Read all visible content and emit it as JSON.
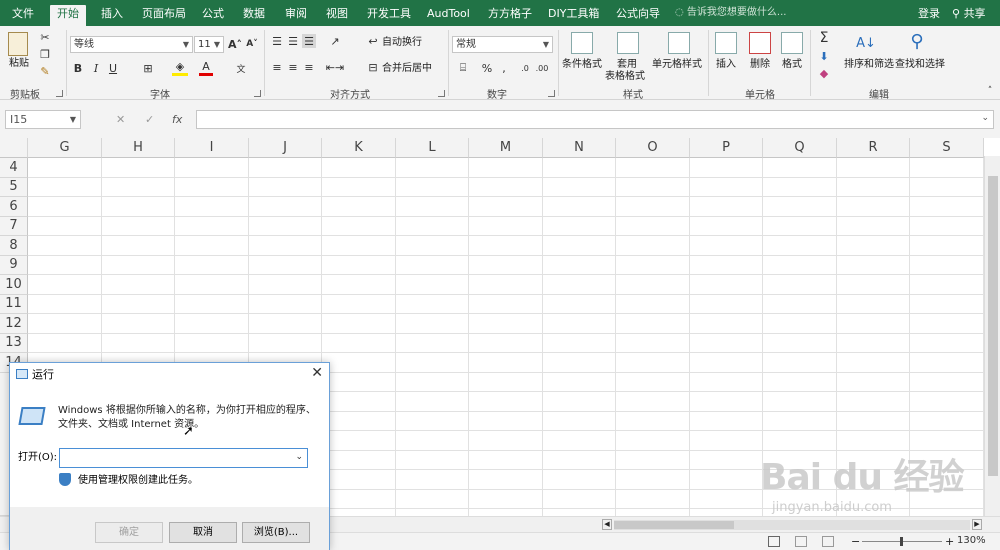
{
  "tabs": [
    "文件",
    "开始",
    "插入",
    "页面布局",
    "公式",
    "数据",
    "审阅",
    "视图",
    "开发工具",
    "AudTool",
    "方方格子",
    "DIY工具箱",
    "公式向导"
  ],
  "active_tab": "开始",
  "tell_me": "告诉我您想要做什么...",
  "login": "登录",
  "share": "共享",
  "ribbon": {
    "groups": [
      "剪贴板",
      "字体",
      "对齐方式",
      "数字",
      "样式",
      "单元格",
      "编辑"
    ],
    "paste": "粘贴",
    "font_name": "等线",
    "font_size": "11",
    "bold": "B",
    "italic": "I",
    "underline": "U",
    "wrap_text": "自动换行",
    "merge_center": "合并后居中",
    "number_format": "常规",
    "percent": "%",
    "cond_format": "条件格式",
    "table_format_1": "套用",
    "table_format_2": "表格格式",
    "cell_styles": "单元格样式",
    "insert": "插入",
    "delete": "删除",
    "format": "格式",
    "sort_filter": "排序和筛选",
    "find_select": "查找和选择"
  },
  "name_box": "I15",
  "fx": "fx",
  "columns": [
    "G",
    "H",
    "I",
    "J",
    "K",
    "L",
    "M",
    "N",
    "O",
    "P",
    "Q",
    "R",
    "S"
  ],
  "rows": [
    "4",
    "5",
    "6",
    "7",
    "8",
    "9",
    "10",
    "11",
    "12",
    "13",
    "14"
  ],
  "dialog": {
    "title": "运行",
    "description": "Windows 将根据你所输入的名称，为你打开相应的程序、文件夹、文档或 Internet 资源。",
    "open_label": "打开(O):",
    "open_value": "",
    "admin_note": "使用管理权限创建此任务。",
    "ok": "确定",
    "cancel": "取消",
    "browse": "浏览(B)..."
  },
  "zoom": "130%",
  "watermark": "Bai du 经验",
  "watermark_url": "jingyan.baidu.com",
  "colors": {
    "excel_green": "#217346",
    "ribbon_bg": "#f3f3f3"
  }
}
